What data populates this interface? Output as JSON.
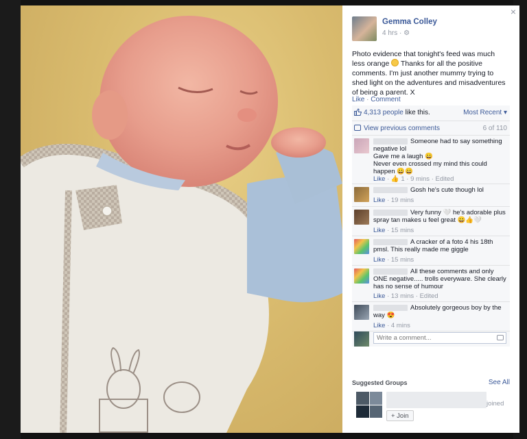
{
  "post": {
    "author": "Gemma Colley",
    "time": "4 hrs · ⚙",
    "text_part1": "Photo evidence that tonight's feed was much less orange ",
    "text_part2": " Thanks for all the positive comments. I'm just another mummy trying to shed light on the adventures and misadventures of being a parent. X",
    "like_label": "Like",
    "comment_label": "Comment"
  },
  "ufi": {
    "likes_count": "4,313 people",
    "likes_suffix": " like this.",
    "sort_label": "Most Recent ▾",
    "previous_comments_label": "View previous comments",
    "previous_comments_count": "6 of 110"
  },
  "comments": [
    {
      "text": "Someone had to say something negative lol",
      "text2": "Gave me a laugh 😀",
      "text3": "Never even crossed my mind this could happen 😀😀",
      "meta_like": "Like",
      "meta_rest": " · 👍 1 · 9 mins · Edited"
    },
    {
      "text": "Gosh he's cute though lol",
      "meta_like": "Like",
      "meta_rest": " · 19 mins"
    },
    {
      "text": "Very funny 🤍 he's adorable plus spray tan makes u feel great 😄👍🤍",
      "meta_like": "Like",
      "meta_rest": " · 15 mins"
    },
    {
      "text": "A cracker of a foto 4 his 18th pmsl. This really made me giggle",
      "meta_like": "Like",
      "meta_rest": " · 15 mins"
    },
    {
      "text": "All these comments and only ONE negative..... trolls everyware. She clearly has no sense of humour",
      "meta_like": "Like",
      "meta_rest": " · 13 mins · Edited"
    },
    {
      "text": "Absolutely gorgeous boy by the way 😍",
      "meta_like": "Like",
      "meta_rest": " · 4 mins"
    }
  ],
  "write_comment_placeholder": "Write a comment...",
  "suggested": {
    "title": "Suggested Groups",
    "see_all": "See All",
    "joined_suffix": "joined",
    "join_button": "+ Join"
  },
  "close_symbol": "×",
  "colors": {
    "link": "#3b5998",
    "meta_grey": "#9197a3",
    "ufi_bg": "#f6f7f9"
  }
}
